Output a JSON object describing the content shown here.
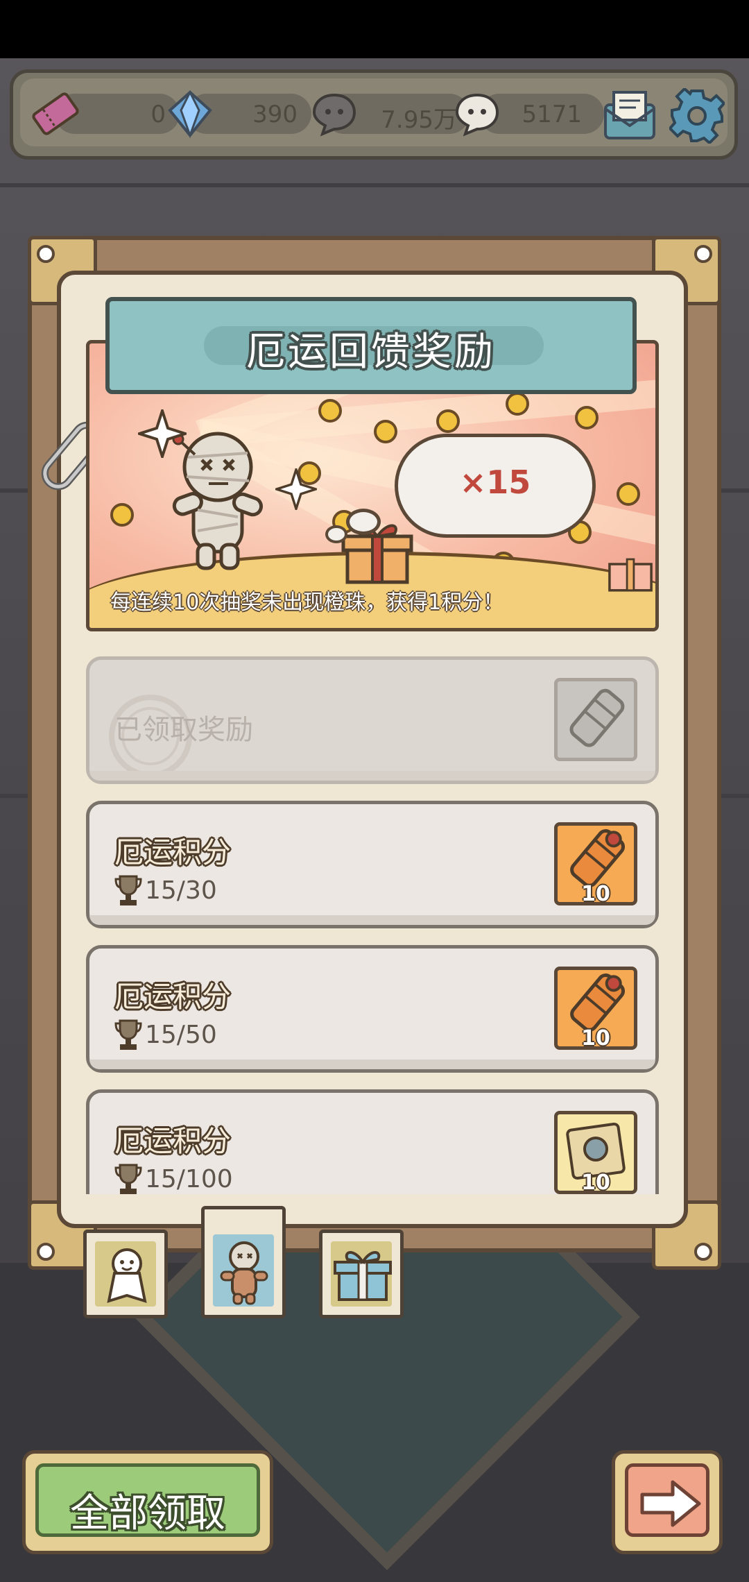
{
  "currencies": [
    {
      "name": "ticket",
      "value": "0"
    },
    {
      "name": "blue-gem",
      "value": "390"
    },
    {
      "name": "dark-chat",
      "value": "7.95万"
    },
    {
      "name": "light-chat",
      "value": "5171"
    }
  ],
  "panel": {
    "title": "厄运回馈奖励",
    "multiplier": "×15",
    "description": "每连续10次抽奖未出现橙珠，获得1积分！"
  },
  "rewards": [
    {
      "state": "claimed",
      "label": "已领取奖励",
      "icon": "gray-cannon-icon"
    },
    {
      "state": "open",
      "title": "厄运积分",
      "progress": "15/30",
      "icon": "orange-cannon-icon",
      "count": "10"
    },
    {
      "state": "open",
      "title": "厄运积分",
      "progress": "15/50",
      "icon": "orange-cannon-icon",
      "count": "10"
    },
    {
      "state": "open",
      "title": "厄运积分",
      "progress": "15/100",
      "icon": "scroll-icon",
      "count": "10"
    }
  ],
  "tabs": [
    {
      "name": "ghost-doll",
      "active": false
    },
    {
      "name": "voodoo-doll",
      "active": true
    },
    {
      "name": "gift-box",
      "active": false
    }
  ],
  "buttons": {
    "claim_all": "全部领取",
    "next": "arrow-right"
  },
  "colors": {
    "title_banner": "#8fc3c3",
    "claim_button": "#9ccc7a",
    "next_button": "#f0a48a",
    "reward_orange": "#f7aa54"
  }
}
